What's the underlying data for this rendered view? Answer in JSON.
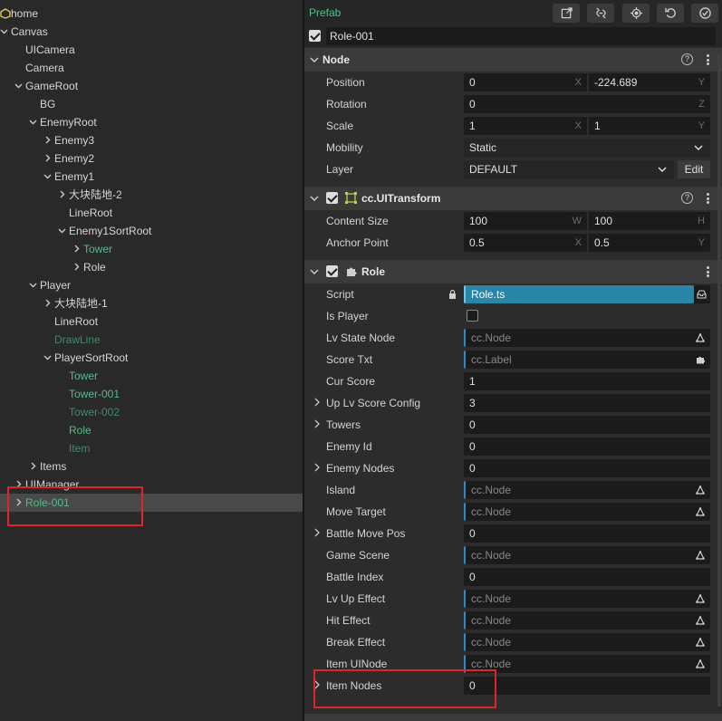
{
  "hierarchy": {
    "rows": [
      {
        "label": "home",
        "expanded": null,
        "style": "normal"
      },
      {
        "label": "Canvas",
        "expanded": true,
        "style": "normal"
      },
      {
        "label": "UICamera",
        "expanded": null,
        "style": "normal"
      },
      {
        "label": "Camera",
        "expanded": null,
        "style": "normal"
      },
      {
        "label": "GameRoot",
        "expanded": true,
        "style": "normal"
      },
      {
        "label": "BG",
        "expanded": null,
        "style": "normal"
      },
      {
        "label": "EnemyRoot",
        "expanded": true,
        "style": "normal"
      },
      {
        "label": "Enemy3",
        "expanded": false,
        "style": "normal"
      },
      {
        "label": "Enemy2",
        "expanded": false,
        "style": "normal"
      },
      {
        "label": "Enemy1",
        "expanded": true,
        "style": "normal"
      },
      {
        "label": "大块陆地-2",
        "expanded": false,
        "style": "normal"
      },
      {
        "label": "LineRoot",
        "expanded": null,
        "style": "normal"
      },
      {
        "label": "Enemy1SortRoot",
        "expanded": true,
        "style": "normal"
      },
      {
        "label": "Tower",
        "expanded": false,
        "style": "prefab"
      },
      {
        "label": "Role",
        "expanded": false,
        "style": "normal"
      },
      {
        "label": "Player",
        "expanded": true,
        "style": "normal"
      },
      {
        "label": "大块陆地-1",
        "expanded": false,
        "style": "normal"
      },
      {
        "label": "LineRoot",
        "expanded": null,
        "style": "normal"
      },
      {
        "label": "DrawLine",
        "expanded": null,
        "style": "prefab-dim"
      },
      {
        "label": "PlayerSortRoot",
        "expanded": true,
        "style": "normal"
      },
      {
        "label": "Tower",
        "expanded": null,
        "style": "prefab"
      },
      {
        "label": "Tower-001",
        "expanded": null,
        "style": "prefab"
      },
      {
        "label": "Tower-002",
        "expanded": null,
        "style": "prefab-dim"
      },
      {
        "label": "Role",
        "expanded": null,
        "style": "prefab"
      },
      {
        "label": "Item",
        "expanded": null,
        "style": "prefab-dim"
      },
      {
        "label": "Items",
        "expanded": false,
        "style": "normal"
      },
      {
        "label": "UIManager",
        "expanded": false,
        "style": "normal"
      },
      {
        "label": "Role-001",
        "expanded": false,
        "style": "prefab",
        "selected": true
      }
    ]
  },
  "inspector": {
    "prefab_label": "Prefab",
    "node_name": "Role-001",
    "toolbar_icons": [
      "open-prefab-icon",
      "unlink-prefab-icon",
      "locate-icon",
      "revert-icon",
      "apply-icon"
    ],
    "node_section": {
      "title": "Node",
      "position": {
        "label": "Position",
        "x": "0",
        "x_axis": "X",
        "y": "-224.689",
        "y_axis": "Y"
      },
      "rotation": {
        "label": "Rotation",
        "z": "0",
        "z_axis": "Z"
      },
      "scale": {
        "label": "Scale",
        "x": "1",
        "x_axis": "X",
        "y": "1",
        "y_axis": "Y"
      },
      "mobility": {
        "label": "Mobility",
        "value": "Static"
      },
      "layer": {
        "label": "Layer",
        "value": "DEFAULT",
        "edit_label": "Edit"
      }
    },
    "uitransform_section": {
      "title": "cc.UITransform",
      "content_size": {
        "label": "Content Size",
        "w": "100",
        "w_axis": "W",
        "h": "100",
        "h_axis": "H"
      },
      "anchor_point": {
        "label": "Anchor Point",
        "x": "0.5",
        "x_axis": "X",
        "y": "0.5",
        "y_axis": "Y"
      }
    },
    "role_section": {
      "title": "Role",
      "props": [
        {
          "label": "Script",
          "value": "Role.ts",
          "kind": "script",
          "expandable": false
        },
        {
          "label": "Is Player",
          "value": "",
          "kind": "checkbox",
          "expandable": false
        },
        {
          "label": "Lv State Node",
          "value": "cc.Node",
          "kind": "node-ref",
          "expandable": false
        },
        {
          "label": "Score Txt",
          "value": "cc.Label",
          "kind": "comp-ref",
          "expandable": false
        },
        {
          "label": "Cur Score",
          "value": "1",
          "kind": "number",
          "expandable": false
        },
        {
          "label": "Up Lv Score Config",
          "value": "3",
          "kind": "number",
          "expandable": true
        },
        {
          "label": "Towers",
          "value": "0",
          "kind": "number",
          "expandable": true
        },
        {
          "label": "Enemy Id",
          "value": "0",
          "kind": "number",
          "expandable": false
        },
        {
          "label": "Enemy Nodes",
          "value": "0",
          "kind": "number",
          "expandable": true
        },
        {
          "label": "Island",
          "value": "cc.Node",
          "kind": "node-ref",
          "expandable": false
        },
        {
          "label": "Move Target",
          "value": "cc.Node",
          "kind": "node-ref",
          "expandable": false
        },
        {
          "label": "Battle Move Pos",
          "value": "0",
          "kind": "number",
          "expandable": true
        },
        {
          "label": "Game Scene",
          "value": "cc.Node",
          "kind": "node-ref",
          "expandable": false
        },
        {
          "label": "Battle Index",
          "value": "0",
          "kind": "number",
          "expandable": false
        },
        {
          "label": "Lv Up Effect",
          "value": "cc.Node",
          "kind": "node-ref",
          "expandable": false
        },
        {
          "label": "Hit Effect",
          "value": "cc.Node",
          "kind": "node-ref",
          "expandable": false
        },
        {
          "label": "Break Effect",
          "value": "cc.Node",
          "kind": "node-ref",
          "expandable": false
        },
        {
          "label": "Item UINode",
          "value": "cc.Node",
          "kind": "node-ref",
          "expandable": false
        },
        {
          "label": "Item Nodes",
          "value": "0",
          "kind": "number",
          "expandable": true
        }
      ]
    }
  },
  "colors": {
    "prefab_green": "#4fbf8a",
    "annotation_red": "#e0242b",
    "script_blue": "#2a86a6"
  }
}
